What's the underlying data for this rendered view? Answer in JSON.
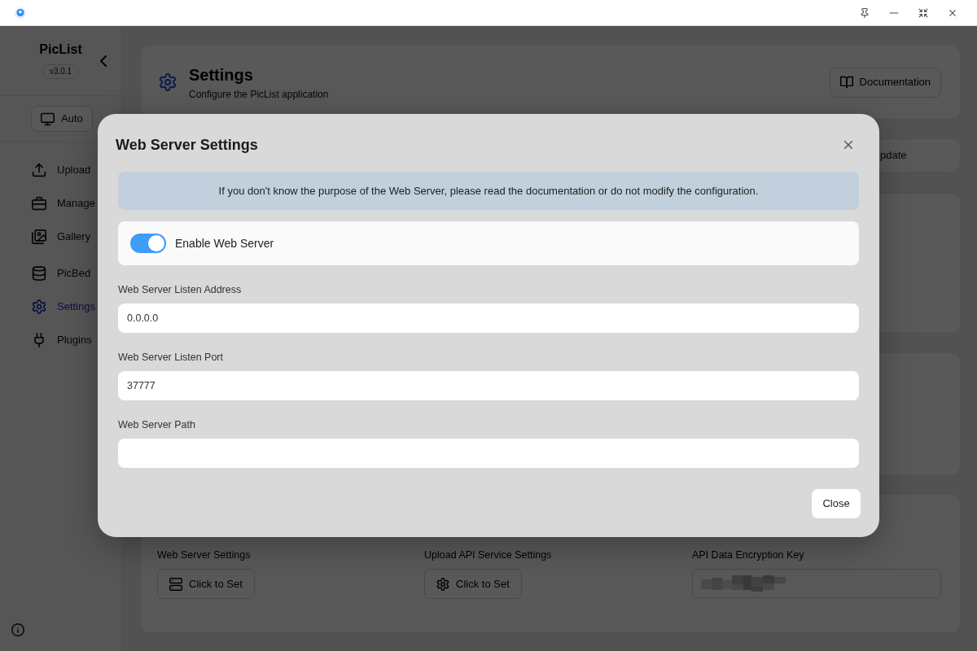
{
  "sidebar": {
    "app_name": "PicList",
    "version": "v3.0.1",
    "theme_button": "Auto",
    "items": [
      {
        "label": "Upload",
        "selected": false
      },
      {
        "label": "Manage",
        "selected": false
      },
      {
        "label": "Gallery",
        "selected": false
      },
      {
        "label": "PicBed",
        "selected": false
      },
      {
        "label": "Settings",
        "selected": true
      },
      {
        "label": "Plugins",
        "selected": false
      }
    ]
  },
  "header": {
    "title": "Settings",
    "subtitle": "Configure the PicList application",
    "button": "Documentation"
  },
  "tabs": [
    {
      "label": "pdate",
      "selected": false
    }
  ],
  "server_settings": {
    "items": [
      {
        "label": "Web Server Settings",
        "kind": "button",
        "button": "Click to Set"
      },
      {
        "label": "Upload API Service Settings",
        "kind": "button",
        "button": "Click to Set"
      },
      {
        "label": "API Data Encryption Key",
        "kind": "secret"
      }
    ]
  },
  "dialog": {
    "title": "Web Server Settings",
    "notice": "If you don't know the purpose of the Web Server, please read the documentation or do not modify the configuration.",
    "toggle": {
      "label": "Enable Web Server",
      "on": true
    },
    "fields": [
      {
        "label": "Web Server Listen Address",
        "value": "0.0.0.0"
      },
      {
        "label": "Web Server Listen Port",
        "value": "37777"
      },
      {
        "label": "Web Server Path"
      }
    ],
    "close_button": "Close"
  }
}
